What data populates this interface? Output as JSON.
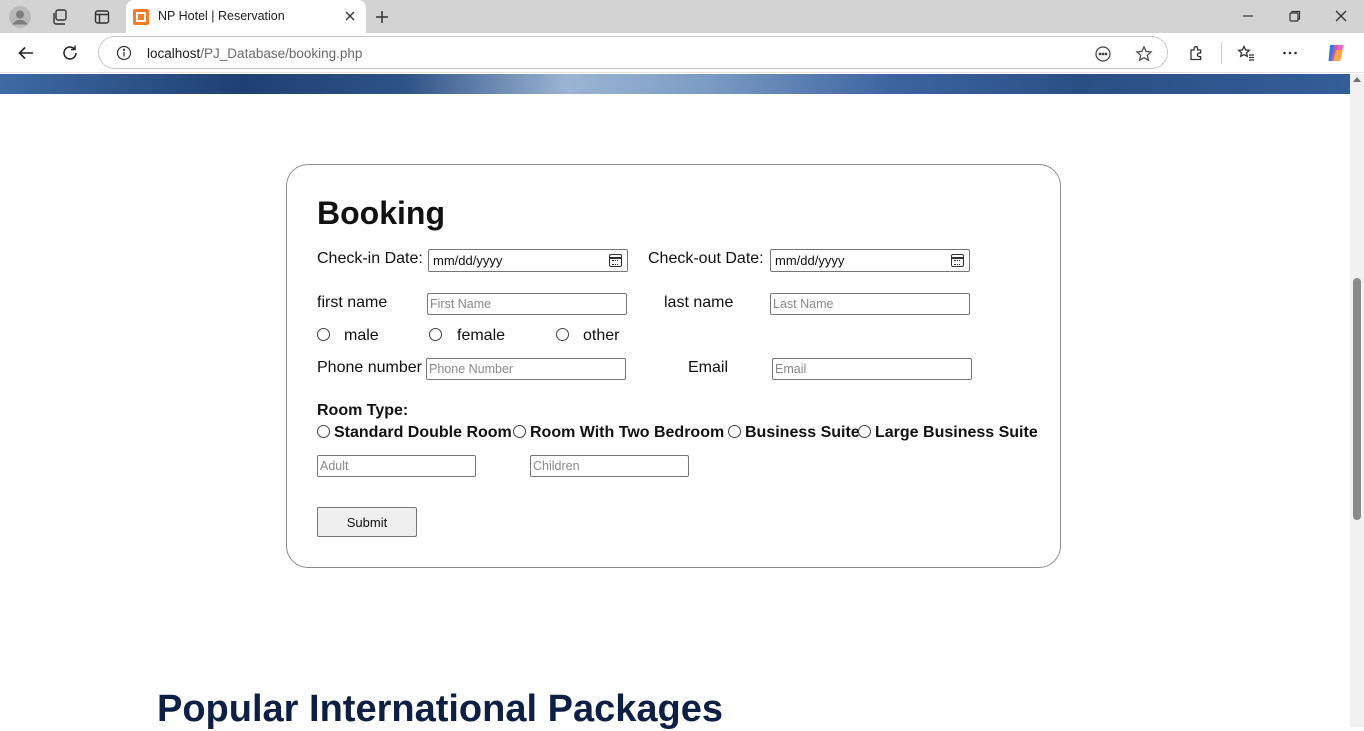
{
  "browser": {
    "tab_title": "NP Hotel | Reservation",
    "url_host": "localhost",
    "url_path": "/PJ_Database/booking.php"
  },
  "form": {
    "title": "Booking",
    "checkin_label": "Check-in Date:",
    "checkin_value": "mm/dd/yyyy",
    "checkout_label": "Check-out Date:",
    "checkout_value": "mm/dd/yyyy",
    "first_name_label": "first name",
    "first_name_placeholder": "First Name",
    "last_name_label": "last name",
    "last_name_placeholder": "Last Name",
    "gender_options": [
      "male",
      "female",
      "other"
    ],
    "phone_label": "Phone number",
    "phone_placeholder": "Phone Number",
    "email_label": "Email",
    "email_placeholder": "Email",
    "room_type_label": "Room Type:",
    "room_types": [
      "Standard Double Room",
      "Room With Two Bedroom",
      "Business Suite",
      "Large Business Suite"
    ],
    "adult_placeholder": "Adult",
    "children_placeholder": "Children",
    "submit_label": "Submit"
  },
  "next_section": {
    "heading": "Popular International Packages"
  },
  "colors": {
    "heading_navy": "#0c1f45",
    "tab_bar": "#d3d3d3",
    "favicon_orange": "#fb7a24"
  },
  "icons": [
    "profile-icon",
    "workspaces-icon",
    "tab-actions-icon",
    "close-icon",
    "plus-icon",
    "minimize-icon",
    "restore-icon",
    "back-icon",
    "refresh-icon",
    "info-icon",
    "read-aloud-icon",
    "favorite-star-icon",
    "extensions-icon",
    "favorites-icon",
    "more-icon",
    "copilot-icon",
    "calendar-icon"
  ]
}
